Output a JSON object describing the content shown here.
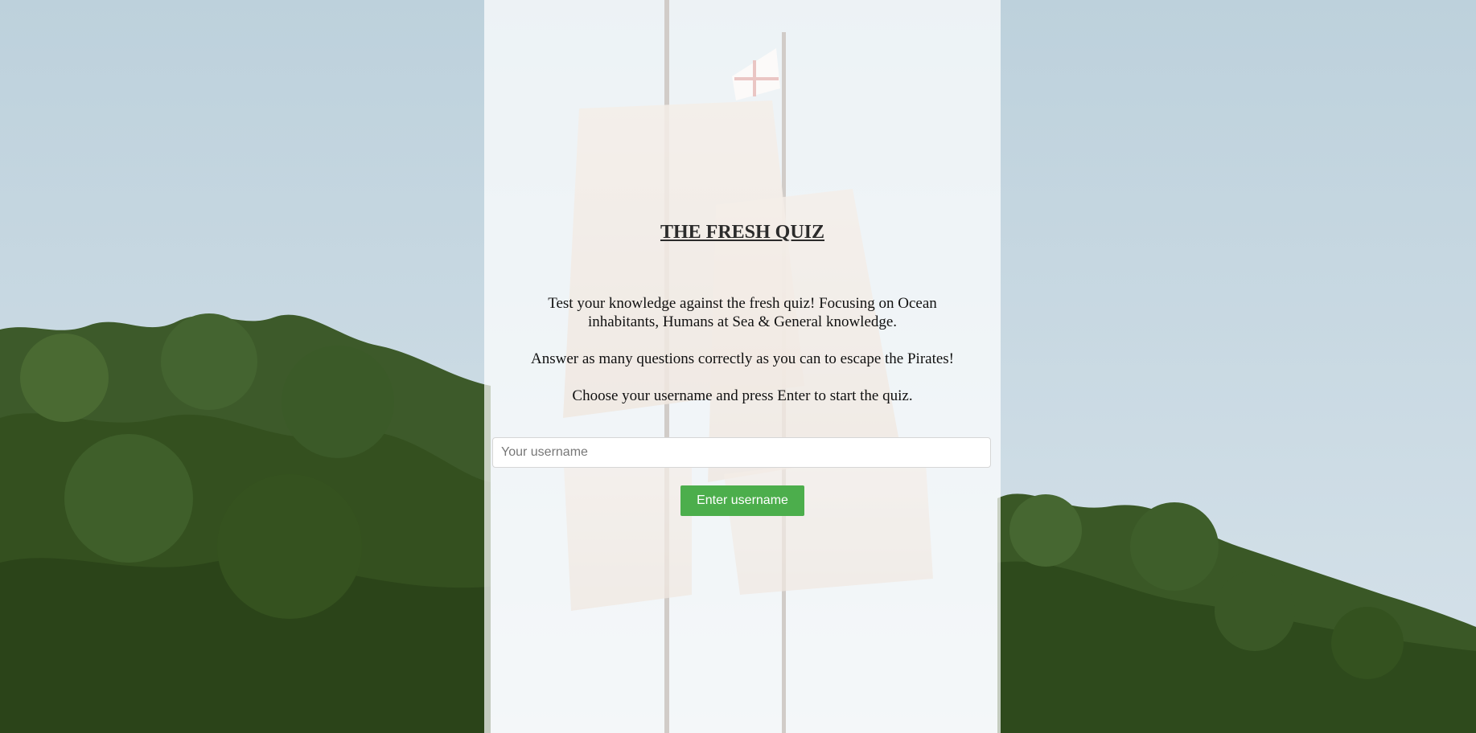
{
  "page": {
    "title": "THE FRESH QUIZ"
  },
  "intro": {
    "line1a": "Test your knowledge against the fresh quiz! Focusing on Ocean",
    "line1b": "inhabitants, Humans at Sea & General knowledge.",
    "line2": "Answer as many questions correctly as you can to escape the Pirates!",
    "line3": "Choose your username and press Enter to start the quiz."
  },
  "form": {
    "username_placeholder": "Your username",
    "username_value": "",
    "submit_label": "Enter username"
  },
  "colors": {
    "button": "#4cae4c",
    "sky": "#c3d5df",
    "trees": "#3e5a2c"
  }
}
